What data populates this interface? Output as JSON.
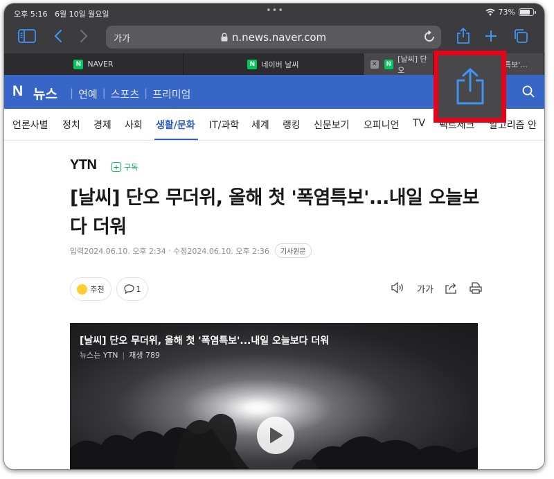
{
  "status": {
    "time": "오후 5:16",
    "date": "6월 10일 월요일",
    "dots": "•••",
    "battery": "73%"
  },
  "browser": {
    "text_size_label": "가가",
    "url": "n.news.naver.com",
    "tabs": [
      {
        "label": "NAVER",
        "active": false
      },
      {
        "label": "네이버 날씨",
        "active": false
      },
      {
        "label": "[날씨] 단오",
        "active": true
      },
      {
        "label": "특보'...",
        "active": false
      }
    ]
  },
  "news_header": {
    "logo": "N",
    "service": "뉴스",
    "links": [
      "연예",
      "스포츠",
      "프리미엄"
    ]
  },
  "categories": {
    "items": [
      "언론사별",
      "정치",
      "경제",
      "사회",
      "생활/문화",
      "IT/과학",
      "세계",
      "랭킹",
      "신문보기",
      "오피니언",
      "TV",
      "팩트체크",
      "알고리즘 안"
    ],
    "active": "생활/문화"
  },
  "article": {
    "press": "YTN",
    "subscribe": "구독",
    "headline": "[날씨] 단오 무더위, 올해 첫 '폭염특보'...내일 오늘보다 더워",
    "input_label": "입력",
    "input_time": "2024.06.10. 오후 2:34",
    "edit_label": "수정",
    "edit_time": "2024.06.10. 오후 2:36",
    "original_button": "기사원문",
    "recommend": "추천",
    "comment_count": "1",
    "text_size": "가가"
  },
  "video": {
    "title": "[날씨] 단오 무더위, 올해 첫 '폭염특보'...내일 오늘보다 더워",
    "channel": "뉴스는 YTN",
    "views_label": "재생 789"
  },
  "colors": {
    "naver_green": "#03c75a",
    "news_blue": "#3866c7",
    "highlight_red": "#e5051a",
    "safari_blue": "#3f94f5"
  }
}
